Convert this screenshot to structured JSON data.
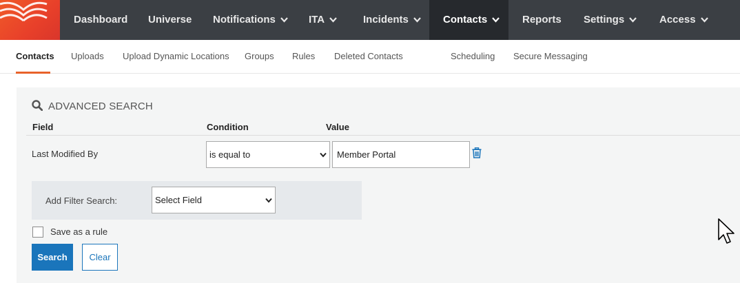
{
  "colors": {
    "nav_bg": "#3b3f44",
    "nav_active_bg": "#26292d",
    "brand_orange": "#e8622a",
    "primary_blue": "#1a75bb"
  },
  "logo": {
    "icon": "brand-logo-icon"
  },
  "nav": {
    "items": [
      {
        "label": "Dashboard",
        "dropdown": false
      },
      {
        "label": "Universe",
        "dropdown": false
      },
      {
        "label": "Notifications",
        "dropdown": true
      },
      {
        "label": "ITA",
        "dropdown": true
      },
      {
        "label": "Incidents",
        "dropdown": true
      },
      {
        "label": "Contacts",
        "dropdown": true,
        "active": true
      },
      {
        "label": "Reports",
        "dropdown": false
      },
      {
        "label": "Settings",
        "dropdown": true
      },
      {
        "label": "Access",
        "dropdown": true
      }
    ]
  },
  "subnav": {
    "items": [
      {
        "label": "Contacts",
        "active": true
      },
      {
        "label": "Uploads"
      },
      {
        "label": "Upload Dynamic Locations"
      },
      {
        "label": "Groups"
      },
      {
        "label": "Rules"
      },
      {
        "label": "Deleted Contacts"
      },
      {
        "label": "Scheduling"
      },
      {
        "label": "Secure Messaging"
      }
    ]
  },
  "search": {
    "title": "ADVANCED SEARCH",
    "columns": {
      "field": "Field",
      "condition": "Condition",
      "value": "Value"
    },
    "rows": [
      {
        "field": "Last Modified By",
        "condition": "is equal to",
        "value": "Member Portal"
      }
    ],
    "add_filter_label": "Add Filter Search:",
    "add_filter_selected": "Select Field",
    "save_rule_label": "Save as a rule",
    "save_rule_checked": false,
    "search_button": "Search",
    "clear_button": "Clear"
  }
}
